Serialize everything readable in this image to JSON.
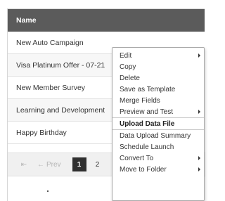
{
  "table": {
    "header": "Name",
    "rows": [
      "New Auto Campaign",
      "Visa Platinum Offer - 07-21",
      "New Member Survey",
      "Learning and Development",
      "Happy Birthday"
    ]
  },
  "pagination": {
    "first_icon": "first-page-icon",
    "prev_label": "Prev",
    "prev_icon": "back-arrow-icon",
    "pages": [
      "1",
      "2"
    ],
    "current_page": "1"
  },
  "context_menu": {
    "items": [
      {
        "label": "Edit",
        "submenu": true
      },
      {
        "label": "Copy",
        "submenu": false
      },
      {
        "label": "Delete",
        "submenu": false
      },
      {
        "label": "Save as Template",
        "submenu": false
      },
      {
        "label": "Merge Fields",
        "submenu": false
      },
      {
        "label": "Preview and Test",
        "submenu": true
      },
      {
        "label": "Upload Data File",
        "submenu": false,
        "highlighted": true
      },
      {
        "label": "Data Upload Summary",
        "submenu": false
      },
      {
        "label": "Schedule Launch",
        "submenu": false
      },
      {
        "label": "Convert To",
        "submenu": true
      },
      {
        "label": "Move to Folder",
        "submenu": true
      }
    ]
  },
  "colors": {
    "header_bg": "#5b5b5b",
    "pager_bg": "#f0f0f0",
    "active_page_bg": "#2f2f2f"
  }
}
